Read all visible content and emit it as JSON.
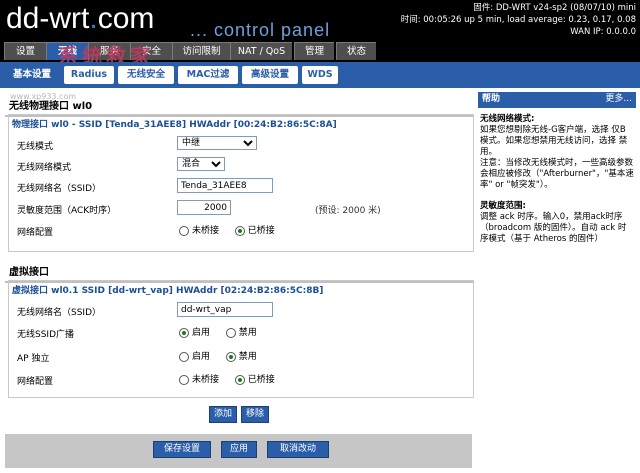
{
  "header": {
    "logo_main": "dd-wrt",
    "logo_dot": ".",
    "logo_com": "com",
    "panel_title": "... control panel",
    "firmware": "固件: DD-WRT v24-sp2 (08/07/10) mini",
    "uptime": "时间: 00:05:26 up 5 min, load average: 0.23, 0.17, 0.08",
    "wan_ip": "WAN IP: 0.0.0.0"
  },
  "main_tabs": [
    {
      "label": "设置"
    },
    {
      "label": "无线"
    },
    {
      "label": "服务"
    },
    {
      "label": "安全"
    },
    {
      "label": "访问限制"
    },
    {
      "label": "NAT / QoS"
    },
    {
      "label": "管理"
    },
    {
      "label": "状态"
    }
  ],
  "sub_tabs": [
    {
      "label": "基本设置"
    },
    {
      "label": "Radius"
    },
    {
      "label": "无线安全"
    },
    {
      "label": "MAC过滤"
    },
    {
      "label": "高级设置"
    },
    {
      "label": "WDS"
    }
  ],
  "watermark": {
    "text": "系统救家",
    "url": "www.xp933.com"
  },
  "physical": {
    "section_title": "无线物理接口 wl0",
    "legend": "物理接口 wl0 - SSID [Tenda_31AEE8] HWAddr [00:24:B2:86:5C:8A]",
    "mode_label": "无线模式",
    "mode_value": "中继",
    "netmode_label": "无线网络模式",
    "netmode_value": "混合",
    "ssid_label": "无线网络名（SSID）",
    "ssid_value": "Tenda_31AEE8",
    "ack_label": "灵敏度范围（ACK时序）",
    "ack_value": "2000",
    "ack_default": "(预设: 2000 米)",
    "netcfg_label": "网络配置",
    "unbridged": "未桥接",
    "bridged": "已桥接"
  },
  "virtual": {
    "section_title": "虚拟接口",
    "legend": "虚拟接口 wl0.1 SSID [dd-wrt_vap] HWAddr [02:24:B2:86:5C:8B]",
    "ssid_label": "无线网络名（SSID）",
    "ssid_value": "dd-wrt_vap",
    "broadcast_label": "无线SSID广播",
    "enable": "启用",
    "disable": "禁用",
    "ap_label": "AP 独立",
    "netcfg_label": "网络配置",
    "unbridged": "未桥接",
    "bridged": "已桥接",
    "add_button": "添加",
    "remove_button": "移除"
  },
  "footer": {
    "save": "保存设置",
    "apply": "应用",
    "cancel": "取消改动"
  },
  "help": {
    "header": "帮助",
    "more": "更多...",
    "t1": "无线网络模式:",
    "p1": "如果您想剔除无线-G客户端，选择 仅B模式。如果您想禁用无线访问，选择 禁用。",
    "p1b": "注意：当修改无线模式时，一些高级参数会相应被修改（\"Afterburner\"，\"基本速率\" or \"帧突发\"）。",
    "t2": "灵敏度范围:",
    "p2": "调整 ack 时序。输入0，禁用ack时序（broadcom 版的固件）。自动 ack 时序模式（基于 Atheros 的固件）"
  }
}
